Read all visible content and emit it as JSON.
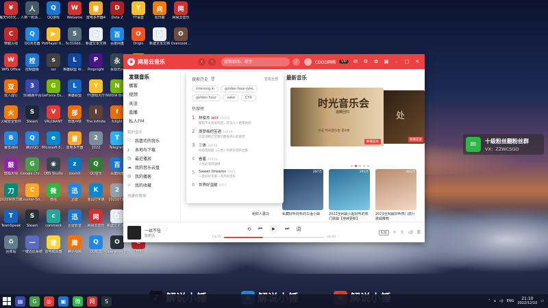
{
  "desktop": {
    "columns": [
      [
        {
          "label": "每天500元人民币",
          "color": "#d32f2f",
          "glyph": "¥"
        },
        {
          "label": "穿越火线",
          "color": "#c62828",
          "glyph": "C"
        },
        {
          "label": "WPS Office",
          "color": "#e53935",
          "glyph": "W"
        },
        {
          "label": "双人成行",
          "color": "#ef6c00",
          "glyph": "双"
        },
        {
          "label": "火绒安全软件",
          "color": "#f57c00",
          "glyph": "火"
        },
        {
          "label": "暴雪战网",
          "color": "#1e88e5",
          "glyph": "B"
        },
        {
          "label": "鼓捣大师",
          "color": "#8e24aa",
          "glyph": "鼓"
        },
        {
          "label": "2022世界刀锋",
          "color": "#00897b",
          "glyph": "刀"
        },
        {
          "label": "TeamSpeak",
          "color": "#1565c0",
          "glyph": "T"
        },
        {
          "label": "回收站",
          "color": "#607d8b",
          "glyph": "♻"
        }
      ],
      [
        {
          "label": "人类一败涂地 Human Fa...",
          "color": "#455a64",
          "glyph": "人"
        },
        {
          "label": "QQ浏览器",
          "color": "#1e88e5",
          "glyph": "Q"
        },
        {
          "label": "控制面板",
          "color": "#1976d2",
          "glyph": "控"
        },
        {
          "label": "3D跑跑平台",
          "color": "#3949ab",
          "glyph": "3"
        },
        {
          "label": "Steam",
          "color": "#1b2838",
          "glyph": "S"
        },
        {
          "label": "腾讯QQ",
          "color": "#1e88e5",
          "glyph": "Q"
        },
        {
          "label": "Google Chrome",
          "color": "#43a047",
          "glyph": "G"
        },
        {
          "label": "Counter-Strike",
          "color": "#f9a825",
          "glyph": "C"
        },
        {
          "label": "Steam",
          "color": "#263238",
          "glyph": "S"
        },
        {
          "label": "一键还原系统",
          "color": "#5c6bc0",
          "glyph": "一"
        }
      ],
      [
        {
          "label": "QQ游戏",
          "color": "#1976d2",
          "glyph": "Q"
        },
        {
          "label": "PotPlayer 64 bit",
          "color": "#fbc02d",
          "glyph": "▶"
        },
        {
          "label": "ssr",
          "color": "#424242",
          "glyph": "s"
        },
        {
          "label": "GeForce Experience",
          "color": "#76b900",
          "glyph": "G"
        },
        {
          "label": "VALORANT",
          "color": "#e53935",
          "glyph": "V"
        },
        {
          "label": "Microsoft Edge",
          "color": "#0288d1",
          "glyph": "e"
        },
        {
          "label": "OBS Studio",
          "color": "#37474f",
          "glyph": "◉"
        },
        {
          "label": "微信",
          "color": "#2db744",
          "glyph": "微"
        },
        {
          "label": "comment",
          "color": "#26a69a",
          "glyph": "c"
        },
        {
          "label": "雷电模拟器",
          "color": "#fdd835",
          "glyph": "雷"
        }
      ],
      [
        {
          "label": "WeGame",
          "color": "#d32f2f",
          "glyph": "W"
        },
        {
          "label": "5c310dd...",
          "color": "#546e7a",
          "glyph": "5"
        },
        {
          "label": "英雄联盟 WeGame版",
          "color": "#0d47a1",
          "glyph": "L"
        },
        {
          "label": "英雄联盟",
          "color": "#1565c0",
          "glyph": "L"
        },
        {
          "label": "部落冲突",
          "color": "#ef6c00",
          "glyph": "部"
        },
        {
          "label": "雷电多开器",
          "color": "#f9a825",
          "glyph": "雷"
        },
        {
          "label": "zoomIt",
          "color": "#0277bd",
          "glyph": "z"
        },
        {
          "label": "迅雷",
          "color": "#1e88e5",
          "glyph": "迅"
        },
        {
          "label": "迅雷影音",
          "color": "#1976d2",
          "glyph": "迅"
        },
        {
          "label": "腾讯视频",
          "color": "#ff6f00",
          "glyph": "腾"
        }
      ],
      [
        {
          "label": "雷电多开器4",
          "color": "#f9a825",
          "glyph": "雷"
        },
        {
          "label": "新建文本文档",
          "color": "#eceff1",
          "glyph": "📄"
        },
        {
          "label": "Propnight",
          "color": "#4a148c",
          "glyph": "P"
        },
        {
          "label": "YY游戏大厅",
          "color": "#fbc02d",
          "glyph": "Y"
        },
        {
          "label": "The Infinite",
          "color": "#5d4037",
          "glyph": "I"
        },
        {
          "label": "2022",
          "color": "#78909c",
          "glyph": "2"
        },
        {
          "label": "QQ音乐",
          "color": "#2e7d32",
          "glyph": "Q"
        },
        {
          "label": "金山打字通",
          "color": "#0288d1",
          "glyph": "K"
        },
        {
          "label": "网易云音乐",
          "color": "#d32f2f",
          "glyph": "网"
        },
        {
          "label": "QQ影音",
          "color": "#1e88e5",
          "glyph": "Q"
        }
      ],
      [
        {
          "label": "Dota 2",
          "color": "#b71c1c",
          "glyph": "D"
        },
        {
          "label": "百度网盘",
          "color": "#1e88e5",
          "glyph": "百"
        },
        {
          "label": "永劫无间",
          "color": "#37474f",
          "glyph": "永"
        },
        {
          "label": "NVIDIA Broadcast",
          "color": "#76b900",
          "glyph": "N"
        },
        {
          "label": "fclight",
          "color": "#ef6c00",
          "glyph": "f"
        },
        {
          "label": "Telegram",
          "color": "#29b6f6",
          "glyph": "T"
        },
        {
          "label": "百度网盘",
          "color": "#1976d2",
          "glyph": "百"
        },
        {
          "label": "20210720",
          "color": "#90a4ae",
          "glyph": "2"
        },
        {
          "label": "新建文本文档",
          "color": "#eceff1",
          "glyph": "📄"
        },
        {
          "label": "Operation Tango",
          "color": "#263238",
          "glyph": "O"
        }
      ],
      [
        {
          "label": "YY语音",
          "color": "#fbc02d",
          "glyph": "Y"
        },
        {
          "label": "Origin",
          "color": "#f4511e",
          "glyph": "O"
        },
        {
          "label": "新建文件夹",
          "color": "#fdd835",
          "glyph": "📁"
        },
        {
          "label": "网络工具",
          "color": "#546e7a",
          "glyph": "网"
        },
        {
          "label": "微信",
          "color": "#2db744",
          "glyph": "微"
        },
        {
          "label": "新建文件夹",
          "color": "#fdd835",
          "glyph": "📁"
        },
        {
          "label": "新建文件夹",
          "color": "#fdd835",
          "glyph": "📁"
        },
        {
          "label": "工作",
          "color": "#fdd835",
          "glyph": "📁"
        },
        {
          "label": "工作",
          "color": "#fdd835",
          "glyph": "📁"
        },
        {
          "label": "CFHD",
          "color": "#c62828",
          "glyph": "C"
        }
      ],
      [
        {
          "label": "向日葵",
          "color": "#f57c00",
          "glyph": "向"
        },
        {
          "label": "新建文本文档",
          "color": "#eceff1",
          "glyph": "📄"
        }
      ],
      [
        {
          "label": "网易云音乐",
          "color": "#d32f2f",
          "glyph": "网"
        },
        {
          "label": "Overcook...",
          "color": "#6d4c41",
          "glyph": "O"
        }
      ]
    ]
  },
  "music_app": {
    "title": "网易云音乐",
    "search_placeholder": "搜索歌曲、歌手",
    "username": "CDDD网络",
    "vip": "VIP",
    "sidebar": {
      "items": [
        "发现音乐",
        "播客",
        "视频",
        "关注",
        "直播",
        "私人FM"
      ],
      "my_music_title": "我的音乐",
      "my_music": [
        {
          "icon": "♡",
          "label": "我喜欢的音乐"
        },
        {
          "icon": "⤓",
          "label": "本地与下载"
        },
        {
          "icon": "◷",
          "label": "最近播放"
        },
        {
          "icon": "☁",
          "label": "我的音乐云盘"
        },
        {
          "icon": "◎",
          "label": "我的播客"
        },
        {
          "icon": "☆",
          "label": "我的收藏"
        }
      ],
      "created_title": "创建的歌单"
    },
    "search_dropdown": {
      "history_title": "搜索历史",
      "view_all": "查看全部",
      "history": [
        "intermig.in",
        "golden hour-jvke",
        "golden hour",
        "vake",
        "CYX"
      ],
      "hot_title": "热搜榜",
      "hot": [
        {
          "rank": "1",
          "name": "林俊杰",
          "tag": "HOT",
          "score": "12000",
          "desc": "都是不太会说的话，其实人一直都很好"
        },
        {
          "rank": "2",
          "name": "周梦梅把苦酒",
          "tag": "",
          "score": "19659",
          "desc": "这是酒精之后我们都很开心的感觉"
        },
        {
          "rank": "3",
          "name": "三体",
          "tag": "",
          "score": "26650",
          "desc": "同名电视剧《三体》的原声音乐合集"
        },
        {
          "rank": "4",
          "name": "看着",
          "tag": "",
          "score": "26424",
          "desc": "人生必须得放肆"
        },
        {
          "rank": "5",
          "name": "Sweet Dreams",
          "tag": "",
          "score": "7805",
          "desc": "一首好听不要一点点的音乐"
        },
        {
          "rank": "6",
          "name": "世界好温暖",
          "tag": "",
          "score": "6457",
          "desc": ""
        }
      ]
    },
    "new_music": {
      "title": "最新音乐",
      "banner_text": "时光音乐会",
      "banner_sub": "温暖回归",
      "banner_caption": "点击 时光音乐会 第4季",
      "banner_tag": "新碟首发",
      "side_banner_text": "处",
      "side_banner_tag": "新碟首发"
    },
    "left_caption": "组织人露马",
    "playlists": [
      {
        "title": "私藏好听好听的华语小曲",
        "count": "287万",
        "colors": [
          "#1e3a5f",
          "#6b8cae"
        ]
      },
      {
        "title": "2022全网最火超好听的热门歌曲【持续更新】",
        "count": "291万",
        "colors": [
          "#2a6f97",
          "#7fc8e8"
        ]
      },
      {
        "title": "2023全网最好听热门流行歌曲推荐",
        "count": "481万",
        "colors": [
          "#b98a6e",
          "#f3d9c3"
        ]
      }
    ],
    "player": {
      "song": "一丝不挂",
      "artist": "陈奕迅",
      "current": "01:50",
      "total": "04:40",
      "progress_fraction": 0.39,
      "quality": "标准"
    }
  },
  "wechat_popup": {
    "title": "十级粉丝翻粉丝群",
    "subtitle": "VX：ZZWCSGO"
  },
  "watermarks": [
    {
      "text": "解说小锤",
      "logo": "♪",
      "color": "#111111"
    },
    {
      "text": "解说小锤",
      "logo": "▣",
      "color": "#1e88e5"
    },
    {
      "text": "解说小锤",
      "logo": "◉",
      "color": "#e53935"
    }
  ],
  "taskbar": {
    "apps": [
      {
        "glyph": "▤",
        "color": "#3949ab"
      },
      {
        "glyph": "G",
        "color": "#43a047"
      },
      {
        "glyph": "◎",
        "color": "#e53935"
      },
      {
        "glyph": "▣",
        "color": "#1976d2"
      },
      {
        "glyph": "微",
        "color": "#2db744"
      },
      {
        "glyph": "网",
        "color": "#d32f2f"
      },
      {
        "glyph": "S",
        "color": "#263238"
      }
    ],
    "lang": "ENG",
    "time": "21:10",
    "date": "2022/12/10"
  }
}
